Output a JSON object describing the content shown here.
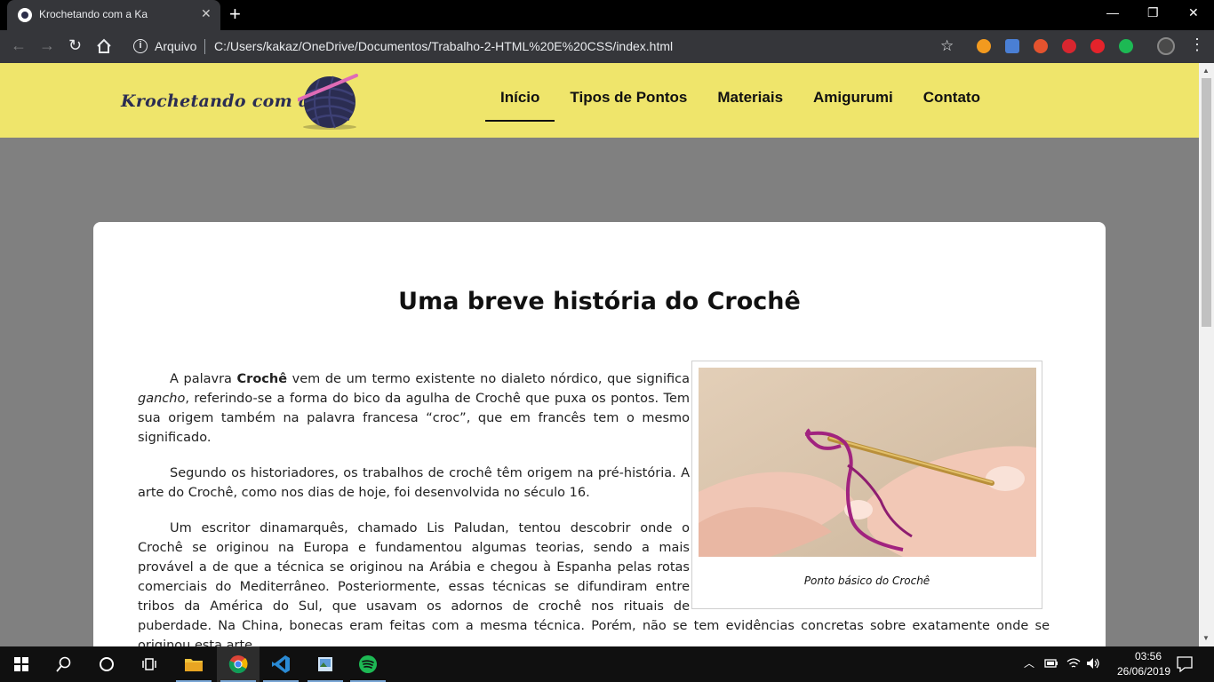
{
  "browser": {
    "tab_title": "Krochetando com a Ka",
    "tab_close": "✕",
    "new_tab": "+",
    "omnibox_label": "Arquivo",
    "url": "C:/Users/kakaz/OneDrive/Documentos/Trabalho-2-HTML%20E%20CSS/index.html",
    "window_controls": [
      "—",
      "❐",
      "✕"
    ]
  },
  "site": {
    "logo_text": "Krochetando com a Ka",
    "nav": [
      "Início",
      "Tipos de Pontos",
      "Materiais",
      "Amigurumi",
      "Contato"
    ],
    "active_nav": "Início",
    "colors": {
      "header_bg": "#efe56b",
      "page_bg": "#808080",
      "card_bg": "#ffffff",
      "logo": "#2b2d52",
      "yarn": "#2b2d52",
      "hook": "#e06bb6"
    }
  },
  "article": {
    "title": "Uma breve história do Crochê",
    "p1_a": "A palavra ",
    "p1_b": "Crochê",
    "p1_c": " vem de um termo existente no dialeto nórdico, que significa ",
    "p1_d": "gancho",
    "p1_e": ", referindo-se a forma do bico da agulha de Crochê que puxa os pontos. Tem sua origem também na palavra francesa “croc”, que em francês tem o mesmo significado.",
    "p2": "Segundo os historiadores, os trabalhos de crochê têm origem na pré-história. A arte do Crochê, como nos dias de hoje, foi desenvolvida no século 16.",
    "p3": "Um escritor dinamarquês, chamado Lis Paludan, tentou descobrir onde o Crochê se originou na Europa e fundamentou algumas teorias, sendo a mais provável a de que a técnica se originou na Arábia e chegou à Espanha pelas rotas comerciais do Mediterrâneo. Posteriormente, essas técnicas se difundiram entre tribos da América do Sul, que usavam os adornos de crochê nos rituais de puberdade. Na China, bonecas eram feitas com a mesma técnica. Porém, não se tem evidências concretas sobre exatamente onde se originou esta arte.",
    "figure_caption": "Ponto básico do Crochê"
  },
  "taskbar": {
    "time": "03:56",
    "date": "26/06/2019",
    "apps": [
      "windows-start-icon",
      "search-icon",
      "cortana-icon",
      "task-view-icon",
      "file-explorer-icon",
      "chrome-icon",
      "vscode-icon",
      "image-viewer-icon",
      "spotify-icon"
    ]
  }
}
